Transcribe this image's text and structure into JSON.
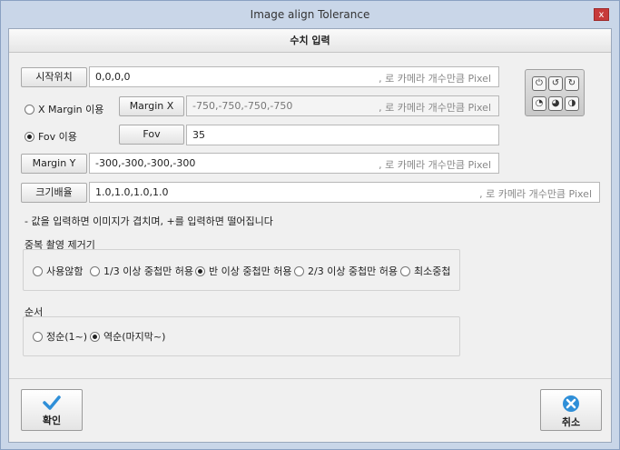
{
  "window": {
    "title": "Image align Tolerance",
    "close_glyph": "x"
  },
  "header": {
    "title": "수치 입력"
  },
  "start_pos": {
    "button": "시작위치",
    "value": "0,0,0,0",
    "hint": ", 로 카메라 개수만큼 Pixel"
  },
  "margin_x": {
    "radio_label": "X Margin 이용",
    "selected": false,
    "button": "Margin X",
    "value": "-750,-750,-750,-750",
    "hint": ", 로 카메라 개수만큼 Pixel"
  },
  "fov": {
    "radio_label": "Fov 이용",
    "selected": true,
    "button": "Fov",
    "value": "35"
  },
  "margin_y": {
    "button": "Margin Y",
    "value": "-300,-300,-300,-300",
    "hint": ", 로 카메라 개수만큼 Pixel"
  },
  "scale": {
    "button": "크기배율",
    "value": "1.0,1.0,1.0,1.0",
    "hint": ", 로 카메라 개수만큼 Pixel"
  },
  "note": "- 값을 입력하면 이미지가 겹치며, +를 입력하면 떨어집니다",
  "dup_group": {
    "label": "중복 촬영 제거기",
    "options": [
      {
        "label": "사용않함",
        "selected": false
      },
      {
        "label": "1/3 이상 중첩만 허용",
        "selected": false
      },
      {
        "label": "반 이상 중첩만 허용",
        "selected": true
      },
      {
        "label": "2/3 이상 중첩만 허용",
        "selected": false
      },
      {
        "label": "최소중첩",
        "selected": false
      }
    ]
  },
  "order_group": {
    "label": "순서",
    "options": [
      {
        "label": "정순(1~)",
        "selected": false
      },
      {
        "label": "역순(마지막~)",
        "selected": true
      }
    ]
  },
  "icons": [
    "rotate-icon",
    "rotate-left-icon",
    "rotate-right-icon",
    "zoom-icon",
    "zoom-in-icon",
    "zoom-reset-icon"
  ],
  "footer": {
    "ok_label": "확인",
    "cancel_label": "취소"
  },
  "colors": {
    "title_bg": "#c9d6e8",
    "close_red": "#c73a3a",
    "ok_blue": "#2f8fd8",
    "cancel_blue": "#2f8fd8"
  }
}
